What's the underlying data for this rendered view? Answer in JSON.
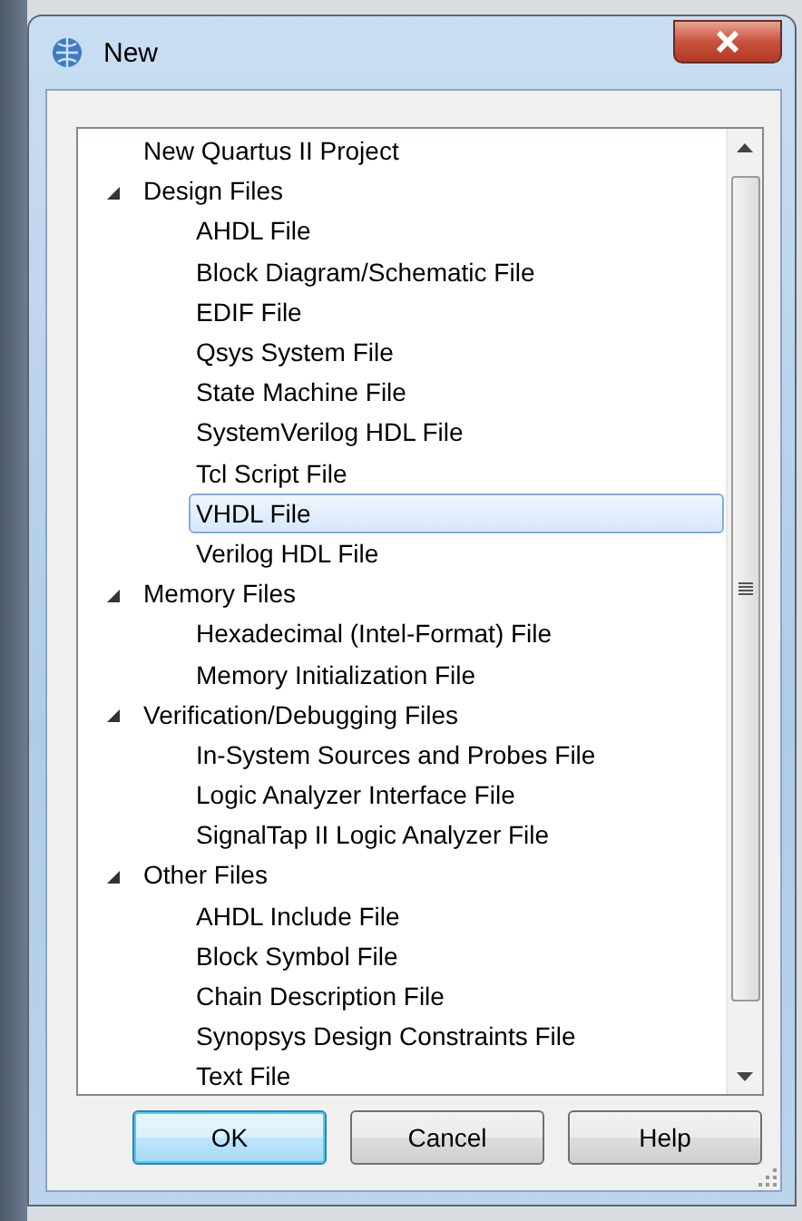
{
  "window": {
    "title": "New"
  },
  "tree": [
    {
      "label": "New Quartus II Project",
      "selected": false
    },
    {
      "label": "Design Files",
      "selected": false,
      "expanded": true,
      "children": [
        {
          "label": "AHDL File",
          "selected": false
        },
        {
          "label": "Block Diagram/Schematic File",
          "selected": false
        },
        {
          "label": "EDIF File",
          "selected": false
        },
        {
          "label": "Qsys System File",
          "selected": false
        },
        {
          "label": "State Machine File",
          "selected": false
        },
        {
          "label": "SystemVerilog HDL File",
          "selected": false
        },
        {
          "label": "Tcl Script File",
          "selected": false
        },
        {
          "label": "VHDL File",
          "selected": true
        },
        {
          "label": "Verilog HDL File",
          "selected": false
        }
      ]
    },
    {
      "label": "Memory Files",
      "selected": false,
      "expanded": true,
      "children": [
        {
          "label": "Hexadecimal (Intel-Format) File",
          "selected": false
        },
        {
          "label": "Memory Initialization File",
          "selected": false
        }
      ]
    },
    {
      "label": "Verification/Debugging Files",
      "selected": false,
      "expanded": true,
      "children": [
        {
          "label": "In-System Sources and Probes File",
          "selected": false
        },
        {
          "label": "Logic Analyzer Interface File",
          "selected": false
        },
        {
          "label": "SignalTap II Logic Analyzer File",
          "selected": false
        }
      ]
    },
    {
      "label": "Other Files",
      "selected": false,
      "expanded": true,
      "children": [
        {
          "label": "AHDL Include File",
          "selected": false
        },
        {
          "label": "Block Symbol File",
          "selected": false
        },
        {
          "label": "Chain Description File",
          "selected": false
        },
        {
          "label": "Synopsys Design Constraints File",
          "selected": false
        },
        {
          "label": "Text File",
          "selected": false
        }
      ]
    }
  ],
  "buttons": [
    {
      "label": "OK",
      "default": true
    },
    {
      "label": "Cancel",
      "default": false
    },
    {
      "label": "Help",
      "default": false
    }
  ]
}
